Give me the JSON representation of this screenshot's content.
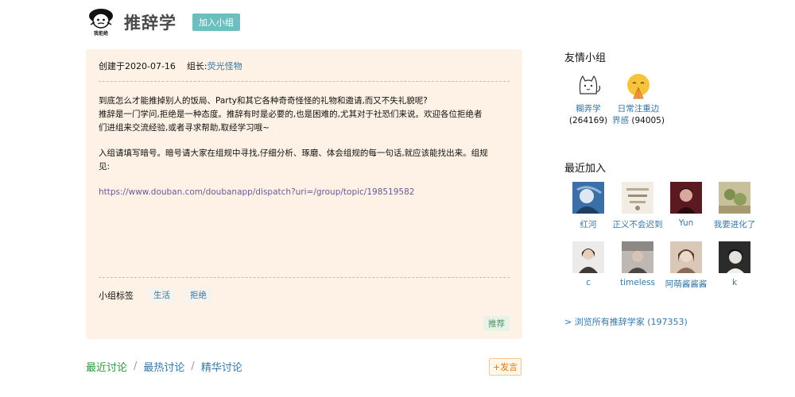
{
  "header": {
    "logo_text": "我拒绝",
    "title": "推辞学",
    "join_label": "加入小组"
  },
  "info": {
    "created": "创建于2020-07-16",
    "leader_label": "组长:",
    "leader_name": "荧光怪物",
    "desc_line1": "到底怎么才能推掉别人的饭局、Party和其它各种奇奇怪怪的礼物和邀请,而又不失礼貌呢?",
    "desc_line2": "推辞是一门学问,拒绝是一种态度。推辞有时是必要的,也是困难的,尤其对于社恐们来说。欢迎各位拒绝者",
    "desc_line3": "们进组来交流经验,或者寻求帮助,取经学习哦~",
    "desc_line4": "入组请填写暗号。暗号请大家在组规中寻找,仔细分析、琢磨、体会组规的每一句话,就应该能找出来。组规",
    "desc_line5": "见:",
    "url": "https://www.douban.com/doubanapp/dispatch?uri=/group/topic/198519582",
    "tags_label": "小组标签",
    "tags": [
      "生活",
      "拒绝"
    ],
    "recommend_label": "推荐"
  },
  "discuss": {
    "tabs": [
      "最近讨论",
      "最热讨论",
      "精华讨论"
    ],
    "separator": "/",
    "post_label": "+发言"
  },
  "sidebar": {
    "friends_title": "友情小组",
    "friends": [
      {
        "name": "糊弄学",
        "count": "(264169)"
      },
      {
        "name": "日常注重边界感",
        "name_line1": "日常注重边",
        "name_line2": "界感",
        "count": "(94005)"
      }
    ],
    "recent_title": "最近加入",
    "members": [
      "红河",
      "正义不会迟到",
      "Yun",
      "我要进化了",
      "c",
      "timeless",
      "阿萌酱酱酱",
      "k"
    ],
    "browse_all": "> 浏览所有推辞学家 (197353)"
  }
}
